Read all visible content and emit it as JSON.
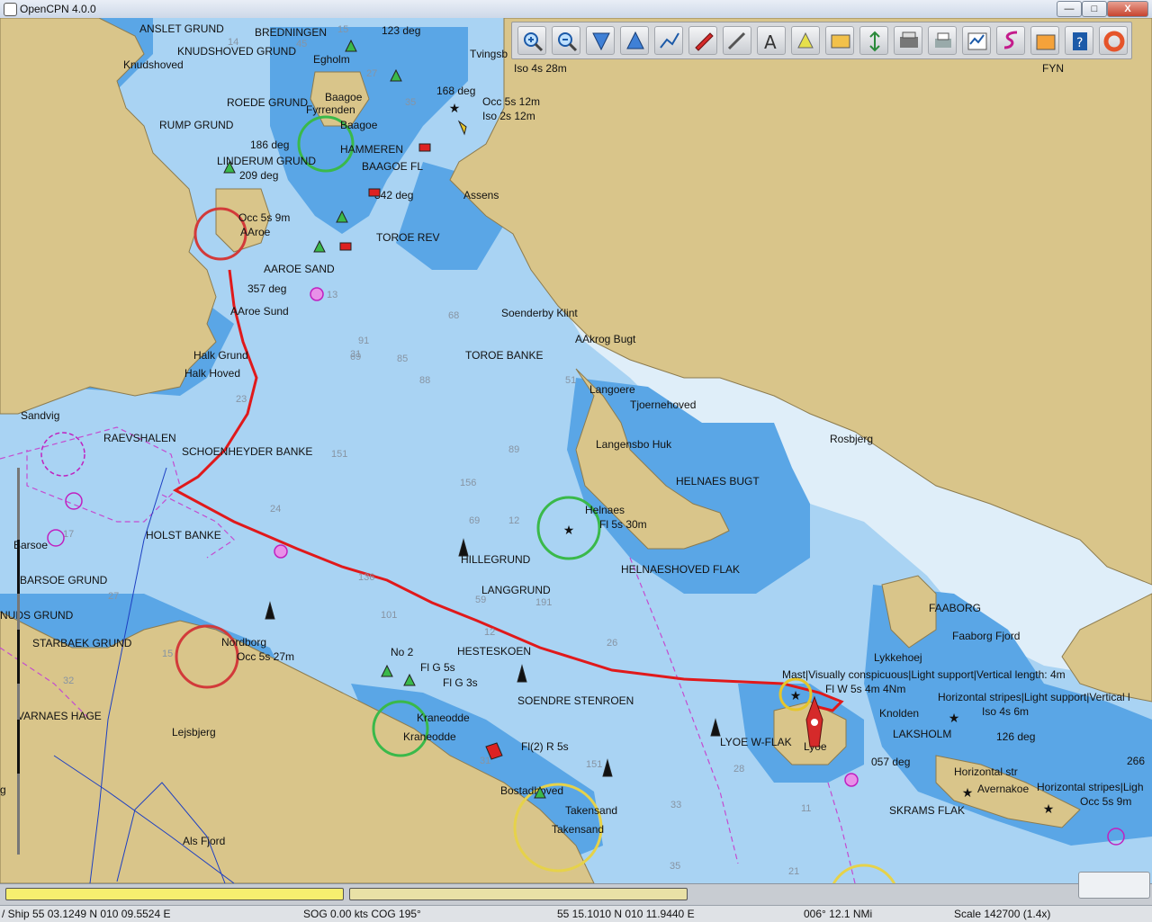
{
  "window": {
    "title": "OpenCPN 4.0.0",
    "minimize": "—",
    "maximize": "□",
    "close": "X"
  },
  "toolbar": {
    "buttons": [
      "zoom-in",
      "zoom-out",
      "lower-chart-scale",
      "raise-chart-scale",
      "route",
      "auto-follow",
      "measure",
      "text",
      "enc-text",
      "tracks",
      "current",
      "tide",
      "print",
      "route-manager",
      "track",
      "ais",
      "help",
      "mob"
    ]
  },
  "chart": {
    "labels": [
      {
        "text": "ANSLET GRUND"
      },
      {
        "text": "BREDNINGEN"
      },
      {
        "text": "123 deg"
      },
      {
        "text": "KNUDSHOVED GRUND"
      },
      {
        "text": "Knudshoved"
      },
      {
        "text": "Egholm"
      },
      {
        "text": "Tvingsb"
      },
      {
        "text": "Iso 4s 28m"
      },
      {
        "text": "FYN"
      },
      {
        "text": "168 deg"
      },
      {
        "text": "Occ 5s 12m"
      },
      {
        "text": "Iso 2s 12m"
      },
      {
        "text": "Baagoe"
      },
      {
        "text": "ROEDE GRUND"
      },
      {
        "text": "Fyrrenden"
      },
      {
        "text": "RUMP GRUND"
      },
      {
        "text": "Baagoe"
      },
      {
        "text": "186 deg"
      },
      {
        "text": "HAMMEREN"
      },
      {
        "text": "LINDERUM GRUND"
      },
      {
        "text": "BAAGOE FL"
      },
      {
        "text": "209 deg"
      },
      {
        "text": "Assens"
      },
      {
        "text": "342 deg"
      },
      {
        "text": "Occ 5s 9m"
      },
      {
        "text": "AAroe"
      },
      {
        "text": "TOROE REV"
      },
      {
        "text": "AAROE SAND"
      },
      {
        "text": "357 deg"
      },
      {
        "text": "AAroe Sund"
      },
      {
        "text": "Soenderby Klint"
      },
      {
        "text": "AAkrog Bugt"
      },
      {
        "text": "TOROE BANKE"
      },
      {
        "text": "Halk Grund"
      },
      {
        "text": "Halk Hoved"
      },
      {
        "text": "Langoere"
      },
      {
        "text": "Tjoernehoved"
      },
      {
        "text": "Sandvig"
      },
      {
        "text": "RAEVSHALEN"
      },
      {
        "text": "SCHOENHEYDER BANKE"
      },
      {
        "text": "Rosbjerg"
      },
      {
        "text": "Langensbo Huk"
      },
      {
        "text": "HELNAES BUGT"
      },
      {
        "text": "Helnaes"
      },
      {
        "text": "Fl 5s 30m"
      },
      {
        "text": "Barsoe"
      },
      {
        "text": "HOLST BANKE"
      },
      {
        "text": "HILLEGRUND"
      },
      {
        "text": "HELNAESHOVED FLAK"
      },
      {
        "text": "BARSOE GRUND"
      },
      {
        "text": "LANGGRUND"
      },
      {
        "text": "FAABORG"
      },
      {
        "text": "Faaborg Fjord"
      },
      {
        "text": "NUDS GRUND"
      },
      {
        "text": "STARBAEK GRUND"
      },
      {
        "text": "Nordborg"
      },
      {
        "text": "Occ 5s 27m"
      },
      {
        "text": "HESTESKOEN"
      },
      {
        "text": "Lykkehoej"
      },
      {
        "text": "No 2"
      },
      {
        "text": "Fl G 5s"
      },
      {
        "text": "Fl G 3s"
      },
      {
        "text": "Mast|Visually conspicuous|Light support|Vertical length: 4m"
      },
      {
        "text": "Fl W 5s 4m 4Nm"
      },
      {
        "text": "SOENDRE STENROEN"
      },
      {
        "text": "Horizontal stripes|Light support|Vertical l"
      },
      {
        "text": "Iso 4s 6m"
      },
      {
        "text": "VARNAES HAGE"
      },
      {
        "text": "Knolden"
      },
      {
        "text": "Kraneodde"
      },
      {
        "text": "Lejsbjerg"
      },
      {
        "text": "Kraneodde"
      },
      {
        "text": "Fl(2) R 5s"
      },
      {
        "text": "LYOE W-FLAK"
      },
      {
        "text": "Lyoe"
      },
      {
        "text": "LAKSHOLM"
      },
      {
        "text": "126 deg"
      },
      {
        "text": "057 deg"
      },
      {
        "text": "Horizontal str"
      },
      {
        "text": "Bostadhoved"
      },
      {
        "text": "Avernakoe"
      },
      {
        "text": "Horizontal stripes|Ligh"
      },
      {
        "text": "Occ 5s 9m"
      },
      {
        "text": "Takensand"
      },
      {
        "text": "Takensand"
      },
      {
        "text": "SKRAMS FLAK"
      },
      {
        "text": "Als Fjord"
      },
      {
        "text": "266"
      },
      {
        "text": "g"
      }
    ],
    "depths": [
      "14",
      "45",
      "15",
      "27",
      "35",
      "13",
      "31",
      "23",
      "69",
      "85",
      "68",
      "88",
      "51",
      "91",
      "24",
      "89",
      "156",
      "69",
      "12",
      "151",
      "136",
      "59",
      "101",
      "12",
      "26",
      "191",
      "15",
      "32",
      "17",
      "27",
      "31",
      "151",
      "33",
      "28",
      "11",
      "35",
      "21"
    ]
  },
  "statusbar": {
    "ship": "/ Ship 55 03.1249 N   010 09.5524 E",
    "sog": "SOG 0.00 kts  COG 195°",
    "cursor": "55 15.1010 N   010 11.9440 E",
    "bearing": "006°  12.1 NMi",
    "scale": "Scale 142700 (1.4x)"
  },
  "colors": {
    "land": "#d9c58a",
    "shallow": "#5aa6e6",
    "medium": "#a9d3f3",
    "deep": "#dfeef9",
    "route": "#e0191b"
  }
}
